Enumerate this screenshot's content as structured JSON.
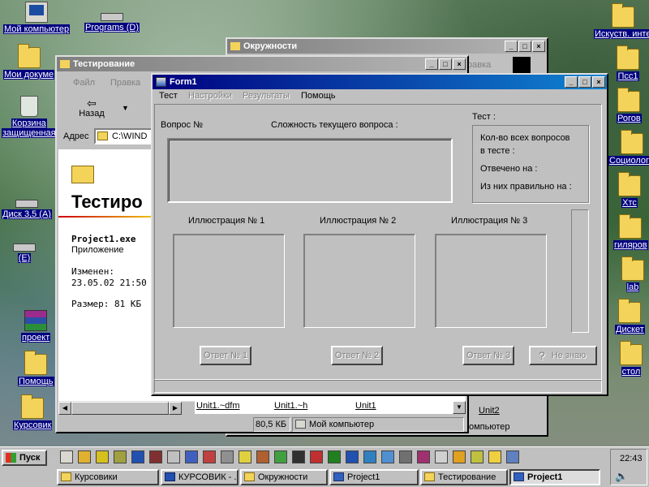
{
  "desktop_icons": [
    {
      "label": "Мой компьютер",
      "icon": "computer-icon"
    },
    {
      "label": "Programs (D)",
      "icon": "drive-icon"
    },
    {
      "label": "Мои докуме",
      "icon": "folder-icon"
    },
    {
      "label": "Корзина",
      "icon": "recycle-bin-icon"
    },
    {
      "label": "защищенная",
      "icon": ""
    },
    {
      "label": "Диск 3,5 (A)",
      "icon": "floppy-icon"
    },
    {
      "label": "(E)",
      "icon": "drive-icon"
    },
    {
      "label": "проект",
      "icon": "winrar-icon"
    },
    {
      "label": "Помощь",
      "icon": "folder-icon"
    },
    {
      "label": "Курсовик",
      "icon": "folder-icon"
    },
    {
      "label": "Искуств. инте",
      "icon": "folder-icon"
    },
    {
      "label": "Псс1",
      "icon": "folder-icon"
    },
    {
      "label": "Рогов",
      "icon": "folder-icon"
    },
    {
      "label": "Социологи",
      "icon": "folder-icon"
    },
    {
      "label": "Хтс",
      "icon": "folder-icon"
    },
    {
      "label": "гиляров",
      "icon": "folder-icon"
    },
    {
      "label": "lab",
      "icon": "folder-icon"
    },
    {
      "label": "Дискет",
      "icon": "folder-icon"
    },
    {
      "label": "стол",
      "icon": "folder-icon"
    }
  ],
  "okruzhnosti": {
    "title": "Окружности",
    "menu_fragment": "равка",
    "status": "омпьютер",
    "file": "Unit2"
  },
  "testirovanie": {
    "title": "Тестирование",
    "menu": [
      "Файл",
      "Правка"
    ],
    "back_label": "Назад",
    "address_label": "Адрес",
    "address_value": "C:\\WIND",
    "heading": "Тестиро",
    "file_name": "Project1.exe",
    "file_type": "Приложение",
    "changed_label": "Изменен:",
    "changed_value": "23.05.02 21:50",
    "size_label": "Размер: 81 КБ",
    "files": [
      "Unit1.~dfm",
      "Unit1.~h",
      "Unit1"
    ],
    "status_size": "80,5 КБ",
    "status_location": "Мой компьютер"
  },
  "form1": {
    "title": "Form1",
    "menu": [
      "Тест",
      "Настройки",
      "Результаты",
      "Помощь"
    ],
    "question_label": "Вопрос №",
    "difficulty_label": "Сложность текущего вопроса :",
    "test_group": "Тест :",
    "total_label_1": "Кол-во всех вопросов",
    "total_label_2": "в тесте :",
    "answered_label": "Отвечено на :",
    "correct_label": "Из них правильно на :",
    "illustrations": [
      "Иллюстрация № 1",
      "Иллюстрация № 2",
      "Иллюстрация № 3"
    ],
    "answers": [
      "Ответ № 1",
      "Ответ № 2",
      "Ответ № 3"
    ],
    "dont_know": "Не знаю"
  },
  "taskbar": {
    "start": "Пуск",
    "clock": "22:43",
    "tasks": [
      {
        "label": "Курсовики",
        "pressed": false
      },
      {
        "label": "КУРСОВИК - ...",
        "pressed": false
      },
      {
        "label": "Окружности",
        "pressed": false
      },
      {
        "label": "Project1",
        "pressed": false
      },
      {
        "label": "Тестирование",
        "pressed": false
      },
      {
        "label": "Project1",
        "pressed": true
      }
    ]
  }
}
